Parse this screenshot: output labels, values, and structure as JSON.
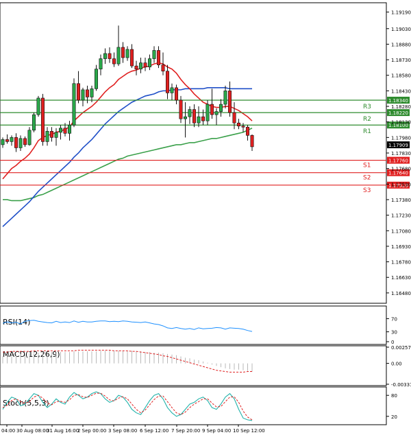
{
  "chart_data": {
    "type": "candlestick",
    "title": "",
    "price_axis": {
      "min": 1.1638,
      "max": 1.1928,
      "ticks": [
        "1.19190",
        "1.19030",
        "1.18880",
        "1.18730",
        "1.18580",
        "1.18430",
        "1.18280",
        "1.18130",
        "1.17980",
        "1.17830",
        "1.17680",
        "1.17530",
        "1.17380",
        "1.17230",
        "1.17080",
        "1.16930",
        "1.16780",
        "1.16630",
        "1.16480"
      ]
    },
    "time_labels": [
      "04:00",
      "30 Aug 08:00",
      "31 Aug 16:00",
      "2 Sep 00:00",
      "3 Sep 08:00",
      "6 Sep 12:00",
      "7 Sep 20:00",
      "9 Sep 04:00",
      "10 Sep 12:00"
    ],
    "current_price": {
      "label": "1.17909",
      "value": 1.17909
    },
    "levels": [
      {
        "name": "R3",
        "label": "1.18340",
        "value": 1.1834,
        "color": "#2e8b2e"
      },
      {
        "name": "R2",
        "label": "1.18220",
        "value": 1.1822,
        "color": "#2e8b2e"
      },
      {
        "name": "R1",
        "label": "1.18100",
        "value": 1.181,
        "color": "#2e8b2e"
      },
      {
        "name": "S1",
        "label": "1.17760",
        "value": 1.1776,
        "color": "#e02020"
      },
      {
        "name": "S2",
        "label": "1.17640",
        "value": 1.1764,
        "color": "#e02020"
      },
      {
        "name": "S3",
        "label": "1.17520",
        "value": 1.1752,
        "color": "#e02020"
      }
    ],
    "candles": [
      [
        1.1791,
        1.1798,
        1.1788,
        1.1796
      ],
      [
        1.1796,
        1.1801,
        1.1792,
        1.1794
      ],
      [
        1.1794,
        1.18,
        1.179,
        1.1798
      ],
      [
        1.1798,
        1.1802,
        1.1784,
        1.1788
      ],
      [
        1.1788,
        1.18,
        1.1785,
        1.1797
      ],
      [
        1.1797,
        1.1799,
        1.1789,
        1.1791
      ],
      [
        1.1791,
        1.1808,
        1.179,
        1.1805
      ],
      [
        1.1805,
        1.1822,
        1.1803,
        1.182
      ],
      [
        1.182,
        1.1838,
        1.1818,
        1.1836
      ],
      [
        1.1836,
        1.184,
        1.179,
        1.1794
      ],
      [
        1.1794,
        1.1808,
        1.179,
        1.1804
      ],
      [
        1.1804,
        1.1808,
        1.1794,
        1.1798
      ],
      [
        1.1798,
        1.1807,
        1.179,
        1.1803
      ],
      [
        1.1803,
        1.181,
        1.1796,
        1.1807
      ],
      [
        1.1807,
        1.1812,
        1.1799,
        1.1802
      ],
      [
        1.1802,
        1.1814,
        1.1795,
        1.181
      ],
      [
        1.181,
        1.1855,
        1.1808,
        1.185
      ],
      [
        1.185,
        1.1862,
        1.1831,
        1.1834
      ],
      [
        1.1834,
        1.1846,
        1.1828,
        1.1844
      ],
      [
        1.1844,
        1.1848,
        1.1831,
        1.1837
      ],
      [
        1.1837,
        1.1848,
        1.1832,
        1.1845
      ],
      [
        1.1845,
        1.1868,
        1.1843,
        1.1864
      ],
      [
        1.1864,
        1.1878,
        1.1858,
        1.1874
      ],
      [
        1.1874,
        1.1884,
        1.1869,
        1.1879
      ],
      [
        1.1879,
        1.1885,
        1.187,
        1.1874
      ],
      [
        1.1874,
        1.188,
        1.1866,
        1.1869
      ],
      [
        1.1869,
        1.1906,
        1.1867,
        1.1885
      ],
      [
        1.1885,
        1.189,
        1.187,
        1.1875
      ],
      [
        1.1875,
        1.1886,
        1.1872,
        1.1883
      ],
      [
        1.1883,
        1.1888,
        1.1865,
        1.1867
      ],
      [
        1.1867,
        1.1872,
        1.1858,
        1.1864
      ],
      [
        1.1864,
        1.1875,
        1.186,
        1.187
      ],
      [
        1.187,
        1.1875,
        1.1862,
        1.1866
      ],
      [
        1.1866,
        1.1878,
        1.1863,
        1.1874
      ],
      [
        1.1874,
        1.1886,
        1.187,
        1.1882
      ],
      [
        1.1882,
        1.1886,
        1.1865,
        1.1868
      ],
      [
        1.1868,
        1.188,
        1.1858,
        1.1862
      ],
      [
        1.1862,
        1.1868,
        1.1835,
        1.1841
      ],
      [
        1.1841,
        1.185,
        1.1834,
        1.1846
      ],
      [
        1.1846,
        1.1849,
        1.183,
        1.1834
      ],
      [
        1.1834,
        1.1838,
        1.1812,
        1.1816
      ],
      [
        1.1816,
        1.1832,
        1.1798,
        1.1818
      ],
      [
        1.1818,
        1.1828,
        1.1811,
        1.1825
      ],
      [
        1.1825,
        1.183,
        1.1808,
        1.1812
      ],
      [
        1.1812,
        1.1828,
        1.1808,
        1.1818
      ],
      [
        1.1818,
        1.1825,
        1.181,
        1.1814
      ],
      [
        1.1814,
        1.1834,
        1.181,
        1.183
      ],
      [
        1.183,
        1.1845,
        1.1816,
        1.182
      ],
      [
        1.182,
        1.1826,
        1.181,
        1.1823
      ],
      [
        1.1823,
        1.1835,
        1.1818,
        1.183
      ],
      [
        1.183,
        1.1848,
        1.1826,
        1.1843
      ],
      [
        1.1843,
        1.1852,
        1.1818,
        1.1822
      ],
      [
        1.1822,
        1.1832,
        1.1806,
        1.1812
      ],
      [
        1.1812,
        1.1816,
        1.1806,
        1.1809
      ],
      [
        1.1809,
        1.1812,
        1.1803,
        1.1808
      ],
      [
        1.1808,
        1.181,
        1.1795,
        1.18
      ],
      [
        1.18,
        1.1801,
        1.1785,
        1.1789
      ]
    ],
    "sma_fast": [
      1.1758,
      1.1763,
      1.1768,
      1.1771,
      1.1775,
      1.1778,
      1.1782,
      1.1788,
      1.1795,
      1.1798,
      1.18,
      1.1801,
      1.1803,
      1.1804,
      1.1806,
      1.1808,
      1.1814,
      1.1818,
      1.1822,
      1.1825,
      1.1828,
      1.1832,
      1.1837,
      1.1842,
      1.1846,
      1.1849,
      1.1854,
      1.1857,
      1.186,
      1.1862,
      1.1863,
      1.1865,
      1.1866,
      1.1867,
      1.1869,
      1.187,
      1.1869,
      1.1866,
      1.1864,
      1.186,
      1.1854,
      1.1849,
      1.1845,
      1.184,
      1.1836,
      1.1832,
      1.183,
      1.1828,
      1.1827,
      1.1827,
      1.1828,
      1.1828,
      1.1826,
      1.1824,
      1.1821,
      1.1818,
      1.1814
    ],
    "sma_mid": [
      1.1712,
      1.1716,
      1.172,
      1.1724,
      1.1728,
      1.1732,
      1.1736,
      1.1741,
      1.1746,
      1.175,
      1.1754,
      1.1758,
      1.1762,
      1.1766,
      1.177,
      1.1774,
      1.1779,
      1.1783,
      1.1788,
      1.1792,
      1.1796,
      1.1801,
      1.1806,
      1.1811,
      1.1815,
      1.1819,
      1.1823,
      1.1826,
      1.1829,
      1.1832,
      1.1834,
      1.1836,
      1.1838,
      1.1839,
      1.184,
      1.1842,
      1.1843,
      1.1843,
      1.1844,
      1.1844,
      1.1844,
      1.1845,
      1.1845,
      1.1845,
      1.1845,
      1.1845,
      1.1846,
      1.1846,
      1.1846,
      1.1846,
      1.1846,
      1.1845,
      1.1845,
      1.1845,
      1.1845,
      1.1845,
      1.1845
    ],
    "sma_slow": [
      1.1738,
      1.1738,
      1.1737,
      1.1737,
      1.1737,
      1.1738,
      1.1739,
      1.174,
      1.1742,
      1.1743,
      1.1745,
      1.1747,
      1.1749,
      1.1751,
      1.1753,
      1.1755,
      1.1757,
      1.1759,
      1.1761,
      1.1763,
      1.1765,
      1.1767,
      1.1769,
      1.1771,
      1.1773,
      1.1775,
      1.1777,
      1.1778,
      1.178,
      1.1781,
      1.1782,
      1.1783,
      1.1784,
      1.1785,
      1.1786,
      1.1787,
      1.1788,
      1.1789,
      1.179,
      1.1791,
      1.1791,
      1.1792,
      1.1793,
      1.1793,
      1.1794,
      1.1795,
      1.1796,
      1.1797,
      1.1797,
      1.1798,
      1.1799,
      1.18,
      1.1801,
      1.1802,
      1.1803,
      1.1805,
      1.1807
    ],
    "rsi": {
      "label": "RSI(14)",
      "ticks": [
        "70",
        "30",
        "0"
      ],
      "values": [
        56,
        60,
        57,
        59,
        54,
        62,
        64,
        65,
        62,
        60,
        58,
        57,
        62,
        58,
        60,
        58,
        63,
        59,
        62,
        60,
        60,
        62,
        63,
        63,
        61,
        62,
        61,
        63,
        62,
        60,
        59,
        58,
        60,
        57,
        54,
        52,
        48,
        42,
        40,
        43,
        40,
        38,
        40,
        37,
        42,
        39,
        40,
        41,
        43,
        42,
        38,
        42,
        41,
        40,
        38,
        34,
        31
      ]
    },
    "macd": {
      "label": "MACD(12,26,9)",
      "ticks": [
        "0.002571",
        "0.00",
        "-0.003317"
      ],
      "hist": [
        0.0012,
        0.0013,
        0.0014,
        0.0014,
        0.0015,
        0.0015,
        0.0016,
        0.0016,
        0.0017,
        0.0018,
        0.0018,
        0.0018,
        0.0018,
        0.0018,
        0.0018,
        0.0018,
        0.0019,
        0.0019,
        0.0019,
        0.0019,
        0.0019,
        0.0019,
        0.002,
        0.002,
        0.002,
        0.002,
        0.002,
        0.002,
        0.002,
        0.002,
        0.0019,
        0.0019,
        0.0018,
        0.0018,
        0.0017,
        0.0017,
        0.0016,
        0.0015,
        0.0014,
        0.0013,
        0.0011,
        0.0009,
        0.0008,
        0.0006,
        0.0005,
        0.0003,
        0.0001,
        -0.0002,
        -0.0004,
        -0.0006,
        -0.0008,
        -0.0009,
        -0.001,
        -0.001,
        -0.0011,
        -0.0012,
        -0.0013
      ],
      "signal": [
        0.0018,
        0.0018,
        0.0019,
        0.0019,
        0.0019,
        0.0019,
        0.0019,
        0.002,
        0.002,
        0.002,
        0.002,
        0.002,
        0.002,
        0.002,
        0.002,
        0.002,
        0.002,
        0.0021,
        0.0021,
        0.0021,
        0.0021,
        0.0021,
        0.0021,
        0.0021,
        0.0021,
        0.002,
        0.002,
        0.002,
        0.002,
        0.0019,
        0.0019,
        0.0018,
        0.0017,
        0.0016,
        0.0015,
        0.0014,
        0.0012,
        0.0011,
        0.0009,
        0.0007,
        0.0005,
        0.0003,
        0.0001,
        -0.0001,
        -0.0003,
        -0.0005,
        -0.0007,
        -0.0009,
        -0.0011,
        -0.0012,
        -0.0013,
        -0.0014,
        -0.0014,
        -0.0014,
        -0.0014,
        -0.0013,
        -0.0013
      ]
    },
    "stoch": {
      "label": "Stoch(5,5,3)",
      "ticks": [
        "80",
        "20"
      ],
      "k": [
        40,
        60,
        75,
        70,
        50,
        55,
        70,
        85,
        80,
        60,
        45,
        55,
        70,
        60,
        55,
        75,
        88,
        80,
        70,
        75,
        85,
        90,
        85,
        70,
        60,
        65,
        80,
        75,
        60,
        40,
        30,
        25,
        45,
        65,
        80,
        85,
        70,
        45,
        30,
        20,
        25,
        40,
        55,
        60,
        70,
        75,
        65,
        45,
        40,
        55,
        75,
        85,
        70,
        40,
        15,
        10,
        8
      ],
      "d": [
        45,
        52,
        65,
        70,
        62,
        57,
        62,
        75,
        80,
        72,
        58,
        53,
        62,
        63,
        60,
        67,
        80,
        82,
        76,
        74,
        80,
        86,
        86,
        78,
        67,
        64,
        72,
        76,
        70,
        55,
        40,
        30,
        38,
        53,
        68,
        78,
        78,
        62,
        45,
        30,
        25,
        32,
        45,
        55,
        62,
        70,
        70,
        58,
        47,
        48,
        62,
        75,
        76,
        60,
        35,
        18,
        10
      ]
    }
  }
}
